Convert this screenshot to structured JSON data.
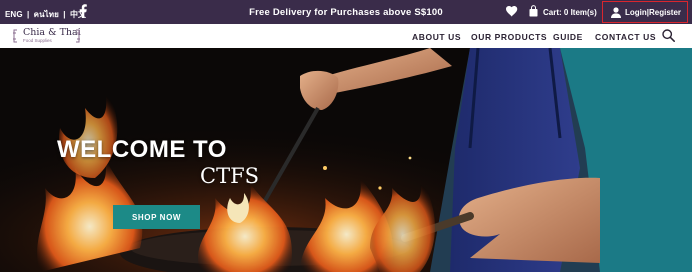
{
  "topbar": {
    "lang_eng": "ENG",
    "lang_thai": "คนไทย",
    "lang_chinese": "中文",
    "separator": "|",
    "promo": "Free Delivery for Purchases above S$100",
    "cart": "Cart: 0 Item(s)",
    "login": "Login|Register"
  },
  "logo": {
    "brand": "Chia & Thai",
    "tagline": "Food Supplies"
  },
  "nav": {
    "items": [
      "ABOUT US",
      "OUR PRODUCTS",
      "GUIDE",
      "CONTACT US"
    ]
  },
  "hero": {
    "welcome": "WELCOME TO",
    "brand": "CTFS",
    "cta": "SHOP NOW"
  },
  "colors": {
    "topbar_bg": "#3a2c4a",
    "accent_teal": "#1c8a87",
    "login_border": "#d9262e",
    "nav_text": "#2b2233"
  },
  "icons": [
    "facebook-icon",
    "heart-icon",
    "shopping-bag-icon",
    "user-icon",
    "search-icon"
  ]
}
